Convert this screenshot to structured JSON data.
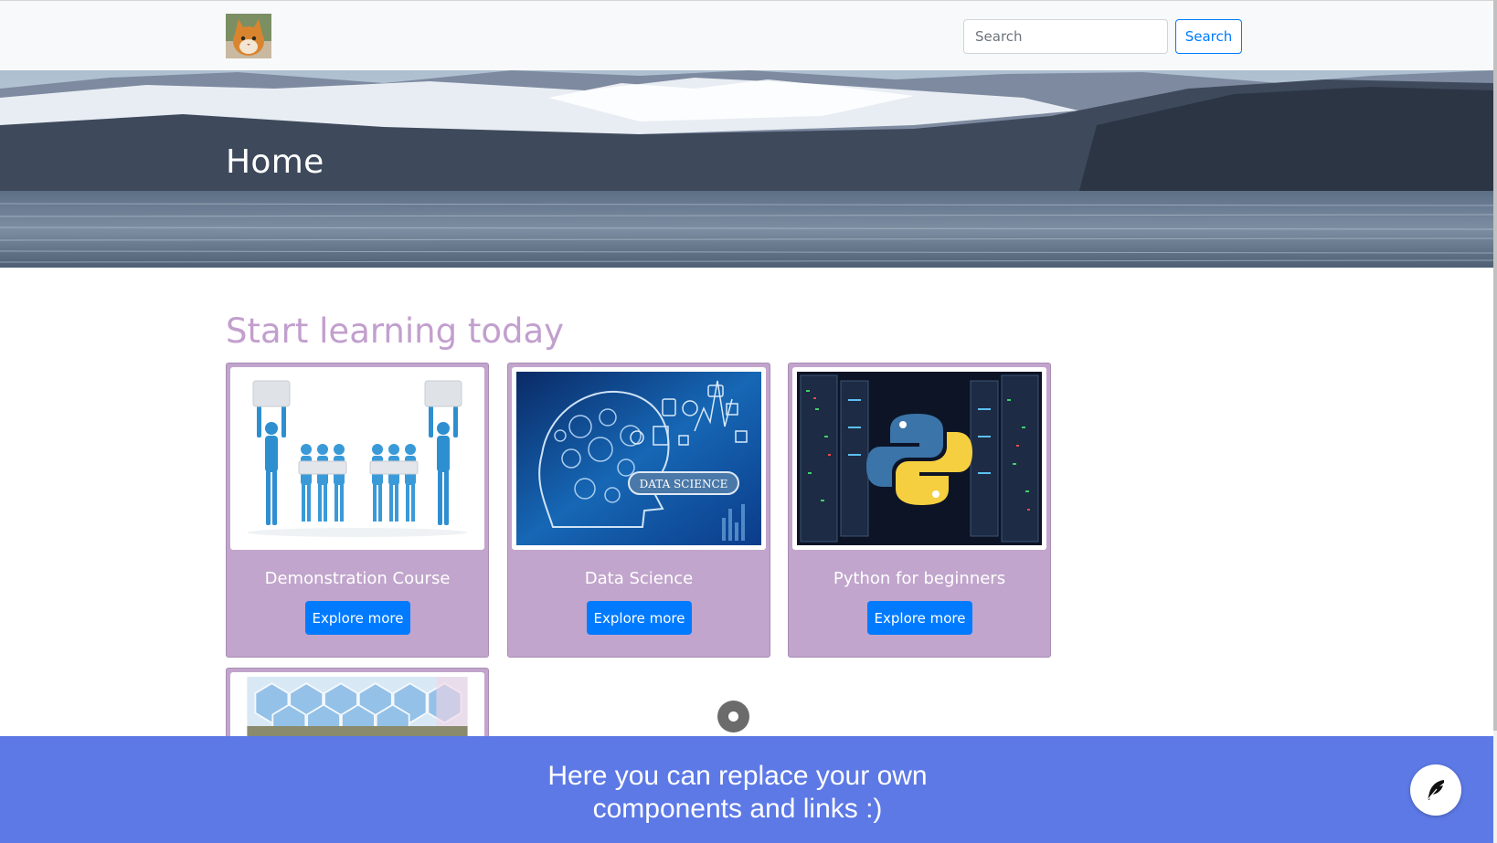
{
  "navbar": {
    "logo_alt": "cat logo",
    "search": {
      "placeholder": "Search",
      "value": "",
      "button_label": "Search"
    }
  },
  "hero": {
    "title": "Home"
  },
  "section": {
    "title": "Start learning today"
  },
  "courses": [
    {
      "title": "Demonstration Course",
      "button_label": "Explore more",
      "image": "puzzle-people-image"
    },
    {
      "title": "Data Science",
      "button_label": "Explore more",
      "image": "data-science-image",
      "image_text": "DATA SCIENCE"
    },
    {
      "title": "Python for beginners",
      "button_label": "Explore more",
      "image": "python-servers-image"
    },
    {
      "title": "",
      "button_label": "",
      "image": "agriculture-hexagon-image"
    }
  ],
  "footer": {
    "line1": "Here you can replace your own",
    "line2": "components and links :)",
    "icon": "feather-icon"
  },
  "colors": {
    "card_background": "#c1a5cc",
    "section_title": "#c29fce",
    "primary": "#007bff",
    "footer_background": "#5d79e6"
  }
}
